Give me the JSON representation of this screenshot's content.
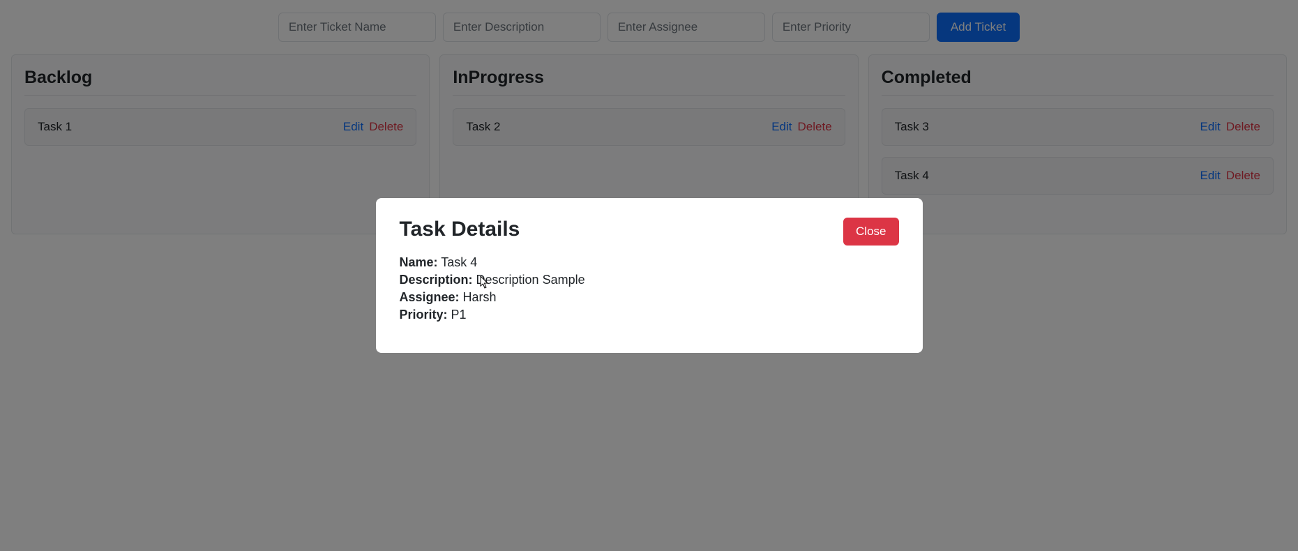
{
  "toolbar": {
    "ticket_name_placeholder": "Enter Ticket Name",
    "description_placeholder": "Enter Description",
    "assignee_placeholder": "Enter Assignee",
    "priority_placeholder": "Enter Priority",
    "add_button_label": "Add Ticket"
  },
  "columns": [
    {
      "title": "Backlog",
      "cards": [
        {
          "name": "Task 1"
        }
      ]
    },
    {
      "title": "InProgress",
      "cards": [
        {
          "name": "Task 2"
        }
      ]
    },
    {
      "title": "Completed",
      "cards": [
        {
          "name": "Task 3"
        },
        {
          "name": "Task 4"
        }
      ]
    }
  ],
  "card_actions": {
    "edit": "Edit",
    "delete": "Delete"
  },
  "modal": {
    "title": "Task Details",
    "close_label": "Close",
    "labels": {
      "name": "Name:",
      "description": "Description:",
      "assignee": "Assignee:",
      "priority": "Priority:"
    },
    "values": {
      "name": "Task 4",
      "description": "Description Sample",
      "assignee": "Harsh",
      "priority": "P1"
    }
  }
}
